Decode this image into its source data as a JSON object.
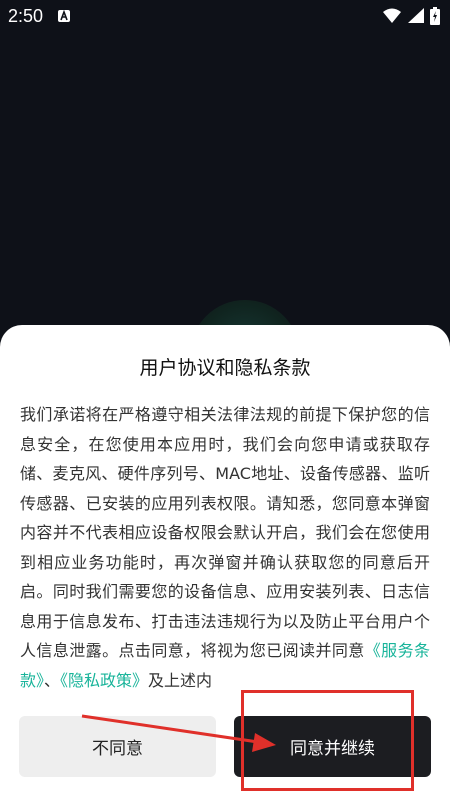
{
  "status_bar": {
    "time": "2:50",
    "notification_icon": "a-badge-icon",
    "icons": [
      "wifi-icon",
      "signal-icon",
      "battery-icon"
    ]
  },
  "dialog": {
    "title": "用户协议和隐私条款",
    "body_text": "我们承诺将在严格遵守相关法律法规的前提下保护您的信息安全，在您使用本应用时，我们会向您申请或获取存储、麦克风、硬件序列号、MAC地址、设备传感器、监听传感器、已安装的应用列表权限。请知悉，您同意本弹窗内容并不代表相应设备权限会默认开启，我们会在您使用到相应业务功能时，再次弹窗并确认获取您的同意后开启。同时我们需要您的设备信息、应用安装列表、日志信息用于信息发布、打击违法违规行为以及防止平台用户个人信息泄露。点击同意，将视为您已阅读并同意",
    "service_terms_link": "《服务条款》",
    "separator": "、",
    "privacy_policy_link": "《隐私政策》",
    "trailing_text": "及上述内",
    "decline_label": "不同意",
    "accept_label": "同意并继续"
  },
  "colors": {
    "background": "#0e1118",
    "link": "#19b49a",
    "accept_button": "#1c1d21",
    "decline_button": "#eeeeee",
    "annotation": "#e0302a"
  }
}
